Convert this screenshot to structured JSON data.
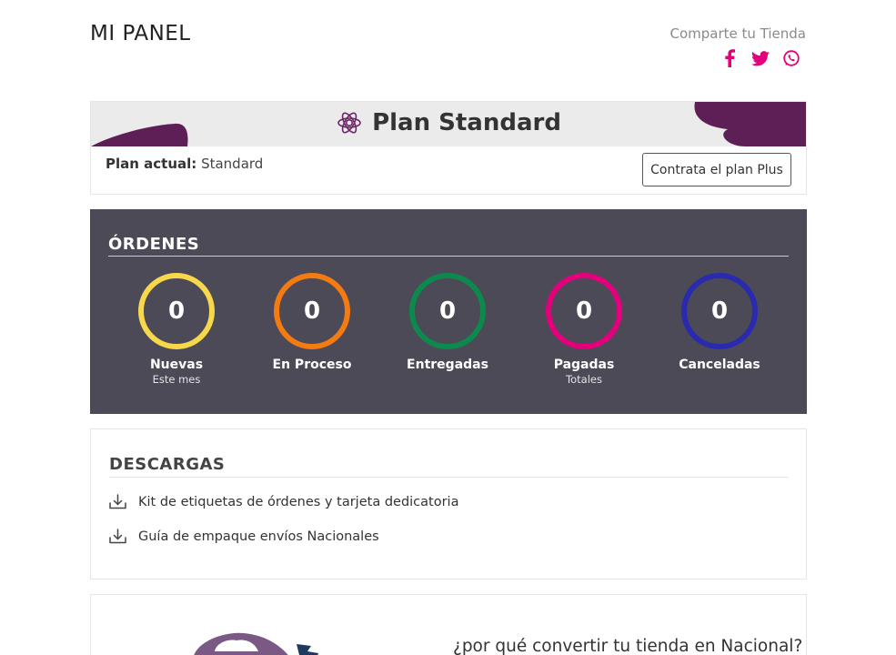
{
  "header": {
    "title": "MI PANEL",
    "share_label": "Comparte tu Tienda",
    "share_icons": [
      "facebook-icon",
      "twitter-icon",
      "whatsapp-icon"
    ],
    "share_color": "#e4007c"
  },
  "plan": {
    "title": "Plan Standard",
    "current_label": "Plan actual:",
    "current_value": "Standard",
    "upgrade_button": "Contrata el plan Plus",
    "accent": "#5e1f57"
  },
  "orders": {
    "title": "ÓRDENES",
    "stats": [
      {
        "value": "0",
        "label": "Nuevas",
        "sub": "Este mes",
        "color": "#f7d84a"
      },
      {
        "value": "0",
        "label": "En Proceso",
        "sub": "",
        "color": "#f47a12"
      },
      {
        "value": "0",
        "label": "Entregadas",
        "sub": "",
        "color": "#0c8a4e"
      },
      {
        "value": "0",
        "label": "Pagadas",
        "sub": "Totales",
        "color": "#e4007c"
      },
      {
        "value": "0",
        "label": "Canceladas",
        "sub": "",
        "color": "#2a2ab0"
      }
    ]
  },
  "downloads": {
    "title": "DESCARGAS",
    "items": [
      {
        "label": "Kit de etiquetas de órdenes y tarjeta dedicatoria",
        "icon": "download-icon"
      },
      {
        "label": "Guía de empaque envíos Nacionales",
        "icon": "download-icon"
      }
    ]
  },
  "promo": {
    "text": "¿por qué convertir tu tienda en Nacional?"
  }
}
